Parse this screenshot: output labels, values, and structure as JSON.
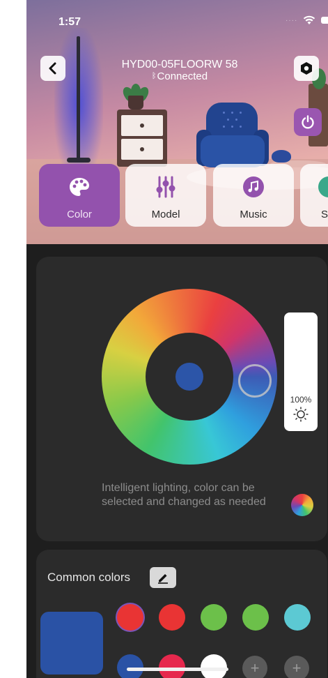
{
  "status_bar": {
    "time": "1:57"
  },
  "header": {
    "device_name": "HYD00-05FLOORW 58",
    "connection_status": "Connected"
  },
  "mode_tabs": [
    {
      "label": "Color",
      "active": true,
      "icon": "palette-icon",
      "color": "#9352ad"
    },
    {
      "label": "Model",
      "active": false,
      "icon": "sliders-icon",
      "color": "#9352ad"
    },
    {
      "label": "Music",
      "active": false,
      "icon": "music-note-icon",
      "color": "#9352ad"
    },
    {
      "label": "S",
      "active": false,
      "icon": "scene-icon",
      "color": "#3aa88a"
    }
  ],
  "color_panel": {
    "selected_color": "#2c55a8",
    "brightness": "100%",
    "description": "Intelligent lighting, color can be selected and changed as needed"
  },
  "common_colors": {
    "title": "Common colors",
    "current_color": "#2a52a5",
    "row1": [
      "#e93434",
      "#e93434",
      "#6cc04a",
      "#6cc04a",
      "#5cc9d3"
    ],
    "row2": [
      "#2a52a5",
      "#e6284d",
      "#ffffff",
      "add",
      "add"
    ]
  }
}
